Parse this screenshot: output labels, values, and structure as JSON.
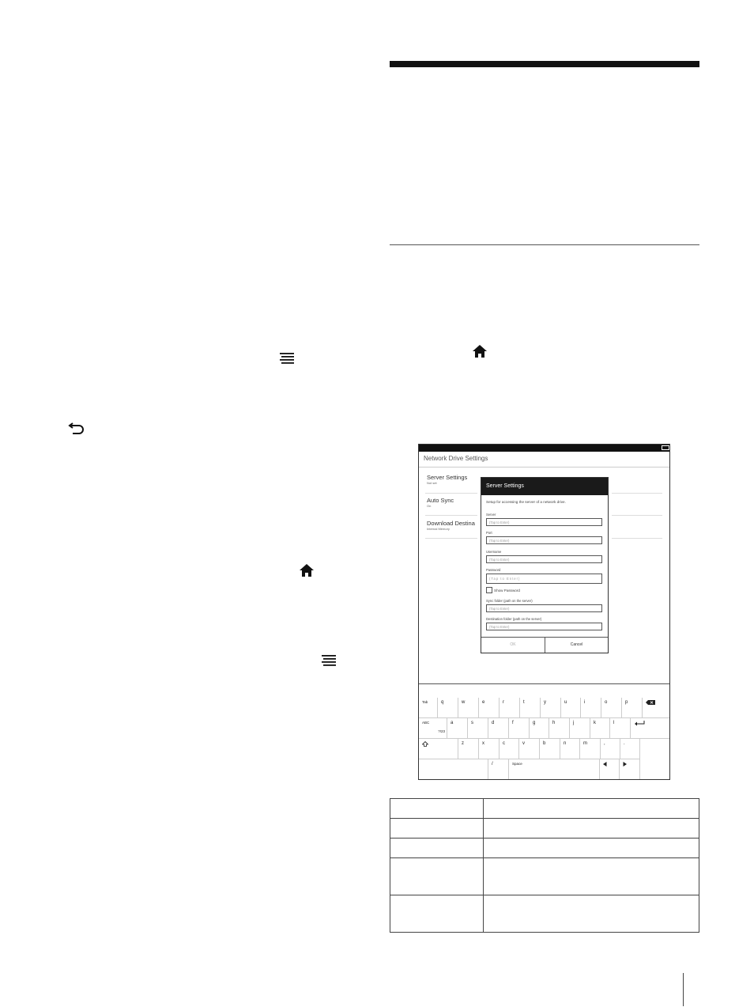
{
  "device": {
    "screen_title": "Network Drive Settings",
    "list_items": [
      {
        "title": "Server Settings",
        "subtitle": "Not set"
      },
      {
        "title": "Auto Sync",
        "subtitle": "On"
      },
      {
        "title": "Download Destina",
        "subtitle": "Internal Memory"
      }
    ],
    "dialog": {
      "title": "Server Settings",
      "description": "Setup for accessing the server of a network drive.",
      "fields": [
        {
          "label": "Server",
          "placeholder": "(Tap to Enter)"
        },
        {
          "label": "Port",
          "placeholder": "(Tap to Enter)"
        },
        {
          "label": "Username",
          "placeholder": "(Tap to Enter)"
        },
        {
          "label": "Password",
          "placeholder": "(Tap to Enter)"
        }
      ],
      "show_password_label": "Show Password",
      "fields_after": [
        {
          "label": "Sync folder (path on the server)",
          "placeholder": "(Tap to Enter)"
        },
        {
          "label": "Destination folder (path on the server)",
          "placeholder": "(Tap to Enter)"
        }
      ],
      "ok_label": "OK",
      "cancel_label": "Cancel"
    },
    "keyboard": {
      "row1": [
        "Tab",
        "q",
        "w",
        "e",
        "r",
        "t",
        "y",
        "u",
        "i",
        "o",
        "p"
      ],
      "row2": [
        "ABC",
        "a",
        "s",
        "d",
        "f",
        "g",
        "h",
        "j",
        "k",
        "l"
      ],
      "row2_sub": "?!23",
      "row3": [
        "z",
        "x",
        "c",
        "v",
        "b",
        "n",
        "m",
        ",",
        "."
      ],
      "row4_slash": "/",
      "row4_space": "Space"
    }
  },
  "icons": [
    "menu-icon",
    "back-icon",
    "home-icon",
    "backspace-icon",
    "enter-icon",
    "shift-icon",
    "arrow-left-icon",
    "arrow-right-icon"
  ]
}
